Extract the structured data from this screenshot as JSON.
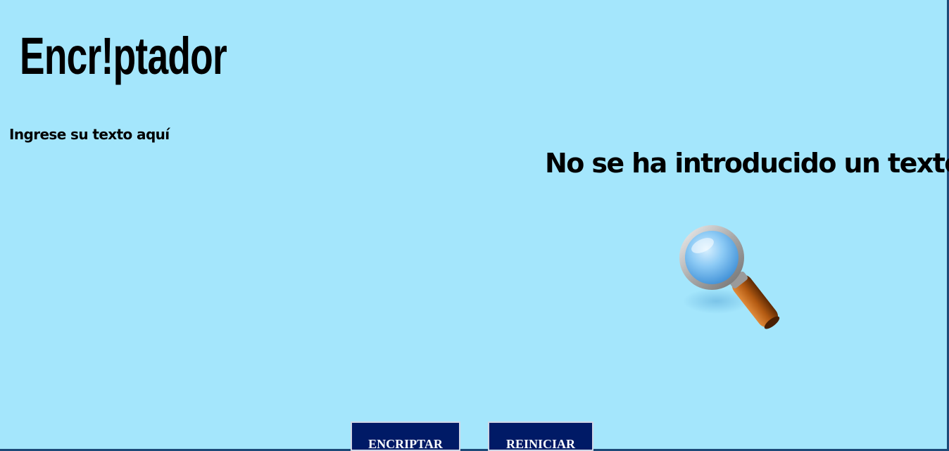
{
  "app": {
    "logo_text": "Encr!ptador"
  },
  "input": {
    "label": "Ingrese su texto aquí",
    "value": "",
    "placeholder": ""
  },
  "output": {
    "empty_message": "No se ha introducido un texto",
    "empty_icon": "magnifying-glass-icon"
  },
  "buttons": {
    "encrypt_label": "ENCRIPTAR",
    "reset_label": "REINICIAR"
  },
  "colors": {
    "background": "#a4e6fc",
    "button_background": "#001a66",
    "button_text": "#ffffff",
    "text": "#000000"
  }
}
